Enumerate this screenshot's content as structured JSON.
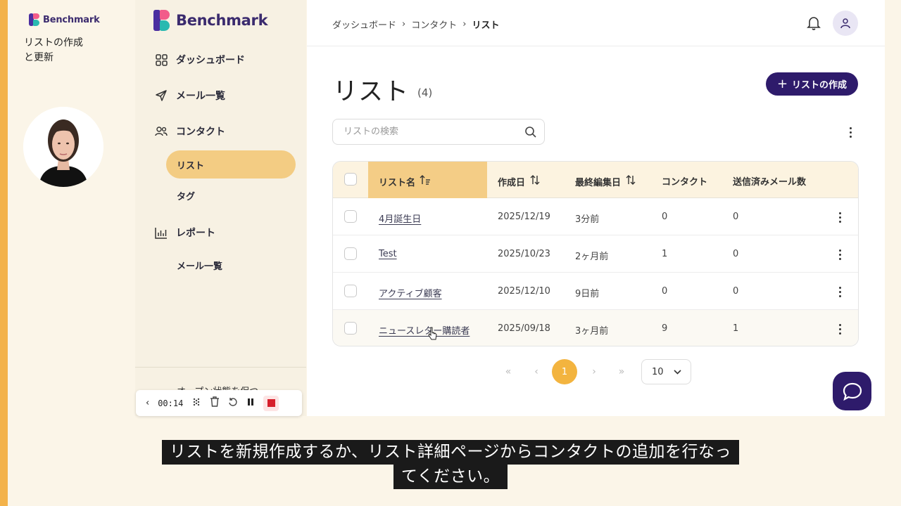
{
  "video": {
    "brand_small": "Benchmark",
    "title": "リストの作成\nと更新",
    "subtitle_line1": "リストを新規作成するか、リスト詳細ページからコンタクトの追加を行なっ",
    "subtitle_line2": "てください。"
  },
  "recorder": {
    "time": "00:14"
  },
  "sidebar": {
    "brand": "Benchmark",
    "items": [
      {
        "label": "ダッシュボード",
        "icon": "dashboard-grid-icon"
      },
      {
        "label": "メール一覧",
        "icon": "paper-plane-icon"
      },
      {
        "label": "コンタクト",
        "icon": "users-icon"
      },
      {
        "label": "リスト",
        "icon": ""
      },
      {
        "label": "タグ",
        "icon": ""
      },
      {
        "label": "レポート",
        "icon": "bar-chart-icon"
      },
      {
        "label": "メール一覧",
        "icon": ""
      }
    ],
    "cut_text": "オープン状態を保つ"
  },
  "header": {
    "breadcrumb": [
      "ダッシュボード",
      "コンタクト",
      "リスト"
    ]
  },
  "page": {
    "title": "リスト",
    "count": "(4)",
    "create_button": "リストの作成",
    "search_placeholder": "リストの検索"
  },
  "table": {
    "columns": [
      "リスト名",
      "作成日",
      "最終編集日",
      "コンタクト",
      "送信済みメール数"
    ],
    "rows": [
      {
        "name": "4月誕生日",
        "created": "2025/12/19",
        "edited": "3分前",
        "contacts": "0",
        "sent": "0"
      },
      {
        "name": "Test",
        "created": "2025/10/23",
        "edited": "2ヶ月前",
        "contacts": "1",
        "sent": "0"
      },
      {
        "name": "アクティブ顧客",
        "created": "2025/12/10",
        "edited": "9日前",
        "contacts": "0",
        "sent": "0"
      },
      {
        "name": "ニュースレター購読者",
        "created": "2025/09/18",
        "edited": "3ヶ月前",
        "contacts": "9",
        "sent": "1"
      }
    ]
  },
  "pagination": {
    "current_page": "1",
    "per_page": "10"
  },
  "colors": {
    "brand_purple": "#2e1b6b",
    "accent_orange": "#f3b43f",
    "sidebar_active": "#f3cc83"
  }
}
